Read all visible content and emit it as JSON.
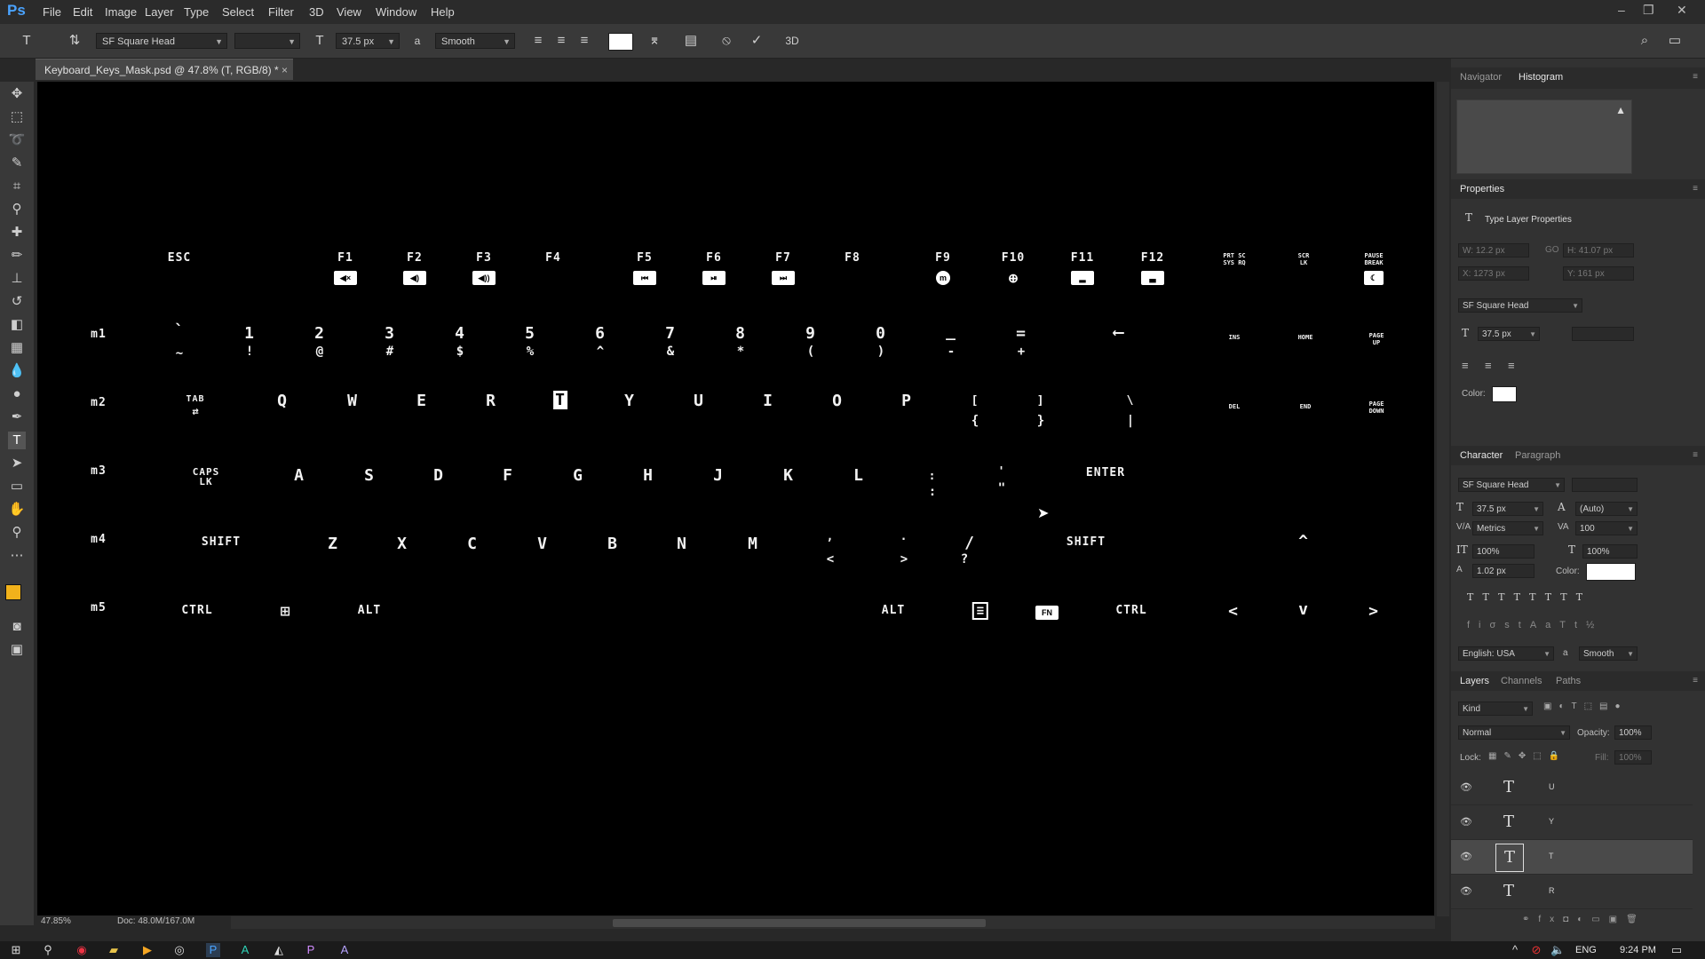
{
  "app": {
    "logo": "Ps"
  },
  "menu": [
    "File",
    "Edit",
    "Image",
    "Layer",
    "Type",
    "Select",
    "Filter",
    "3D",
    "View",
    "Window",
    "Help"
  ],
  "options_bar": {
    "font_family": "SF Square Head",
    "font_style": "",
    "font_size": "37.5 px",
    "aa_label": "a",
    "antialias": "Smooth",
    "text_color": "#ffffff",
    "threed_label": "3D"
  },
  "document": {
    "tab_title": "Keyboard_Keys_Mask.psd @ 47.8% (T, RGB/8) *",
    "zoom": "47.85%",
    "doc_size": "Doc: 48.0M/167.0M"
  },
  "keyboard": {
    "row_fn": [
      "ESC",
      "F1",
      "F2",
      "F3",
      "F4",
      "F5",
      "F6",
      "F7",
      "F8",
      "F9",
      "F10",
      "F11",
      "F12"
    ],
    "row_fn_small": [
      "PRT SC\nSYS RQ",
      "SCR\nLK",
      "PAUSE\nBREAK"
    ],
    "macro": [
      "m1",
      "m2",
      "m3",
      "m4",
      "m5"
    ],
    "row_num_top": [
      "`",
      "1",
      "2",
      "3",
      "4",
      "5",
      "6",
      "7",
      "8",
      "9",
      "0",
      "_",
      "=",
      "⟵"
    ],
    "row_num_bottom": [
      "~",
      "!",
      "@",
      "#",
      "$",
      "%",
      "^",
      "&",
      "*",
      "(",
      ")",
      "-",
      "+"
    ],
    "row_num_small": [
      "INS",
      "HOME",
      "PAGE\nUP"
    ],
    "row_q": [
      "TAB",
      "Q",
      "W",
      "E",
      "R",
      "T",
      "Y",
      "U",
      "I",
      "O",
      "P",
      "[",
      "]",
      "\\"
    ],
    "row_q_bottom": [
      "{",
      "}",
      "|"
    ],
    "row_q_small": [
      "DEL",
      "END",
      "PAGE\nDOWN"
    ],
    "row_a": [
      "CAPS\nLK",
      "A",
      "S",
      "D",
      "F",
      "G",
      "H",
      "J",
      "K",
      "L",
      ":",
      "'",
      "ENTER"
    ],
    "row_a_bottom": [
      ":",
      "\""
    ],
    "row_z": [
      "SHIFT",
      "Z",
      "X",
      "C",
      "V",
      "B",
      "N",
      "M",
      ",",
      ".",
      "/",
      "SHIFT",
      "^"
    ],
    "row_z_bottom": [
      "<",
      ">",
      "?"
    ],
    "row_ctrl": [
      "CTRL",
      "ALT",
      "ALT",
      "FN",
      "CTRL",
      "<",
      "v",
      ">"
    ]
  },
  "panels": {
    "top_tabs": [
      "Navigator",
      "Histogram"
    ],
    "properties_title": "Properties",
    "type_layer_props": "Type Layer Properties",
    "props": {
      "w": "W: 12.2 px",
      "h": "H: 41.07 px",
      "x": "X: 1273 px",
      "y": "Y: 161 px",
      "font": "SF Square Head",
      "size": "37.5 px",
      "color_label": "Color:"
    },
    "char_tabs": [
      "Character",
      "Paragraph"
    ],
    "character": {
      "font": "SF Square Head",
      "size": "37.5 px",
      "leading": "(Auto)",
      "kerning": "Metrics",
      "tracking": "100",
      "vscale": "100%",
      "hscale": "100%",
      "baseline": "1.02 px",
      "color_label": "Color:",
      "language": "English: USA",
      "aa_label": "a",
      "antialias": "Smooth"
    },
    "layer_tabs": [
      "Layers",
      "Channels",
      "Paths"
    ],
    "layers_controls": {
      "kind": "Kind",
      "blend": "Normal",
      "opacity_label": "Opacity:",
      "opacity": "100%",
      "lock_label": "Lock:",
      "fill_label": "Fill:",
      "fill": "100%"
    },
    "layers": [
      {
        "name": "U",
        "selected": false
      },
      {
        "name": "Y",
        "selected": false
      },
      {
        "name": "T",
        "selected": true
      },
      {
        "name": "R",
        "selected": false
      }
    ]
  },
  "taskbar": {
    "lang": "ENG",
    "time": "9:24 PM"
  }
}
